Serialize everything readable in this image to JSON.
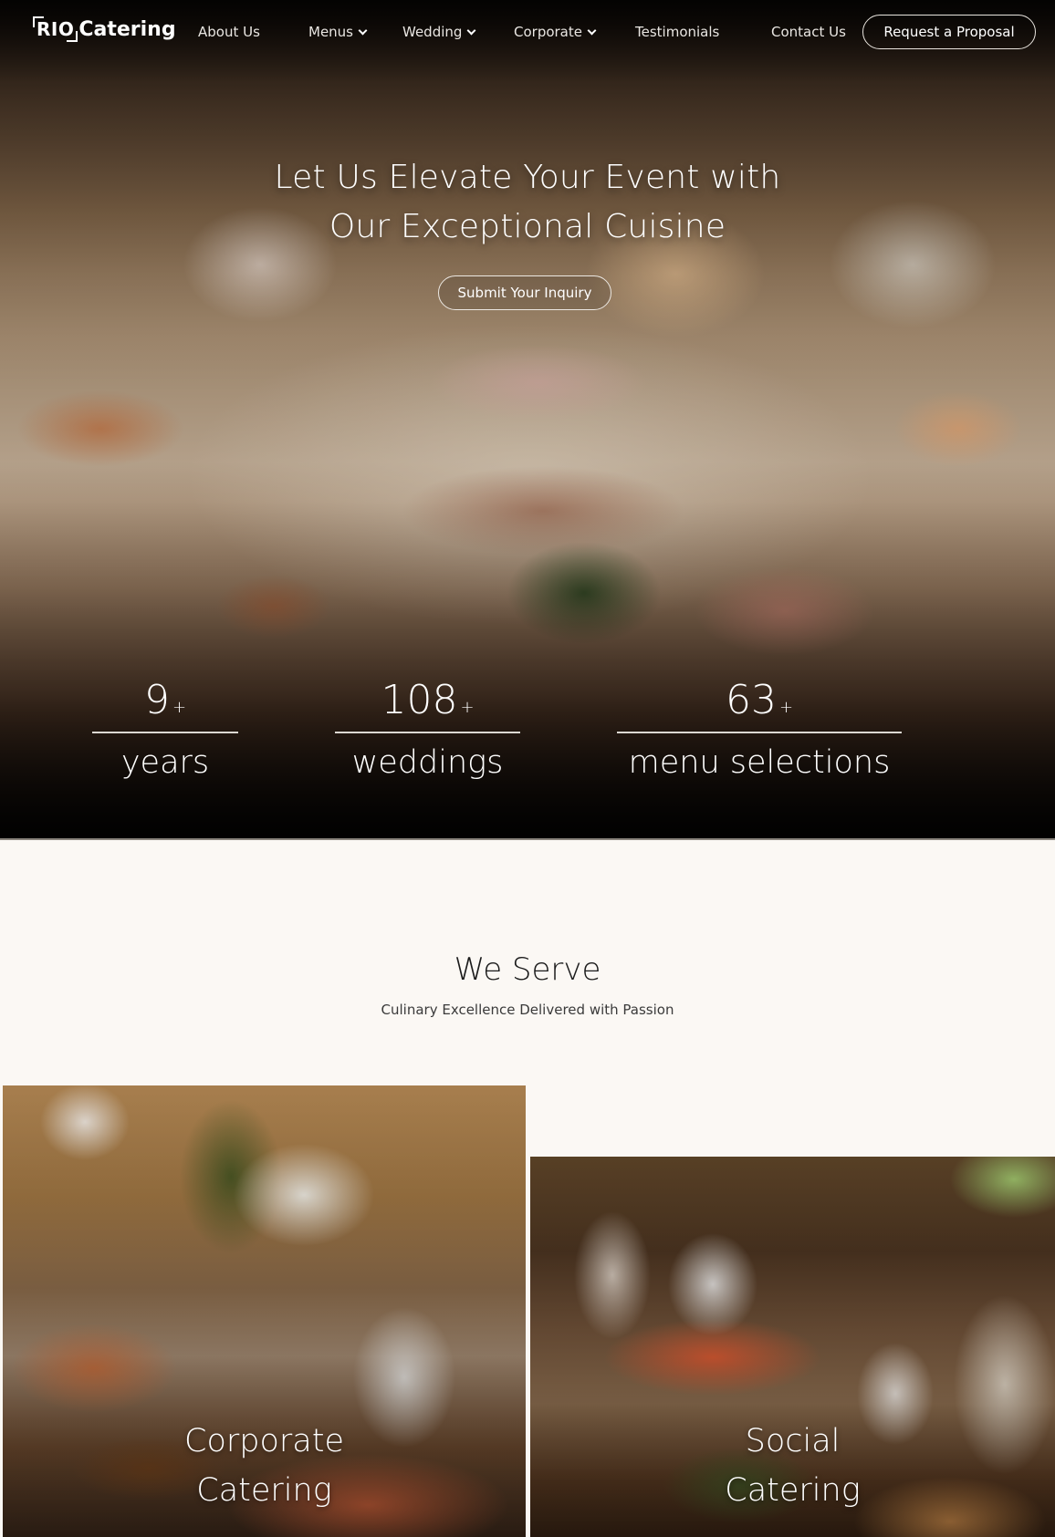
{
  "nav": {
    "logo": {
      "box_text": "RIO",
      "text": "Catering"
    },
    "items": [
      {
        "label": "About Us",
        "has_dropdown": false
      },
      {
        "label": "Menus",
        "has_dropdown": true
      },
      {
        "label": "Wedding",
        "has_dropdown": true
      },
      {
        "label": "Corporate",
        "has_dropdown": true
      },
      {
        "label": "Testimonials",
        "has_dropdown": false
      },
      {
        "label": "Contact Us",
        "has_dropdown": false
      }
    ],
    "cta_label": "Request a Proposal"
  },
  "hero": {
    "title_line1": "Let Us Elevate Your Event with",
    "title_line2": "Our Exceptional Cuisine",
    "button_label": "Submit Your Inquiry",
    "stats": [
      {
        "value": "9",
        "suffix": "+",
        "label": "years"
      },
      {
        "value": "108",
        "suffix": "+",
        "label": "weddings"
      },
      {
        "value": "63",
        "suffix": "+",
        "label": "menu selections"
      }
    ]
  },
  "serve": {
    "title": "We Serve",
    "subtitle": "Culinary Excellence Delivered with Passion",
    "cards": [
      {
        "line1": "Corporate",
        "line2": "Catering"
      },
      {
        "line1": "Social",
        "line2": "Catering"
      }
    ]
  },
  "colors": {
    "page_background": "#fbf8f4",
    "hero_text": "#ffffff",
    "heading_text": "#1b1b1b"
  }
}
